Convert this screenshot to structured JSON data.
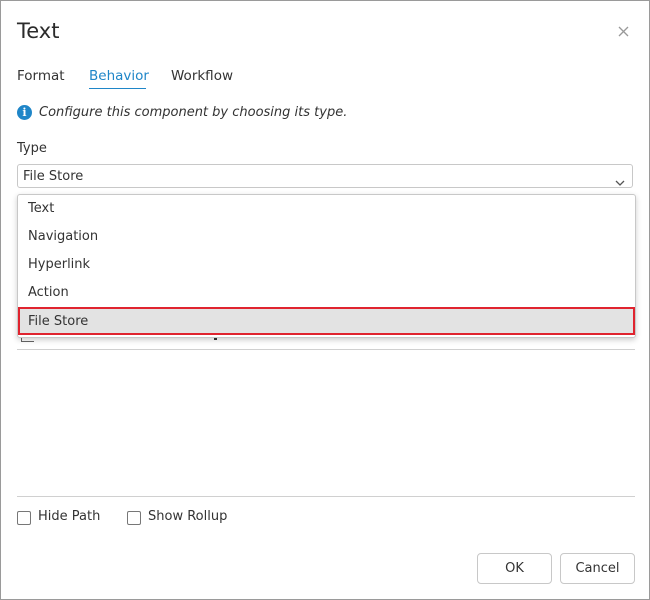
{
  "dialog": {
    "title": "Text"
  },
  "tabs": [
    {
      "label": "Format",
      "active": false
    },
    {
      "label": "Behavior",
      "active": true
    },
    {
      "label": "Workflow",
      "active": false
    }
  ],
  "info": {
    "icon": "info-icon",
    "text": "Configure this component by choosing its type."
  },
  "type_field": {
    "label": "Type",
    "value": "File Store"
  },
  "dropdown": {
    "options": [
      "Text",
      "Navigation",
      "Hyperlink",
      "Action",
      "File Store"
    ],
    "selected": "File Store"
  },
  "options": {
    "hide_path": {
      "label": "Hide Path",
      "checked": false
    },
    "show_rollup": {
      "label": "Show Rollup",
      "checked": false
    }
  },
  "buttons": {
    "ok": "OK",
    "cancel": "Cancel"
  },
  "colors": {
    "accent": "#1f86c8",
    "highlight_border": "#e0242f",
    "selected_bg": "#e3e3e3"
  }
}
